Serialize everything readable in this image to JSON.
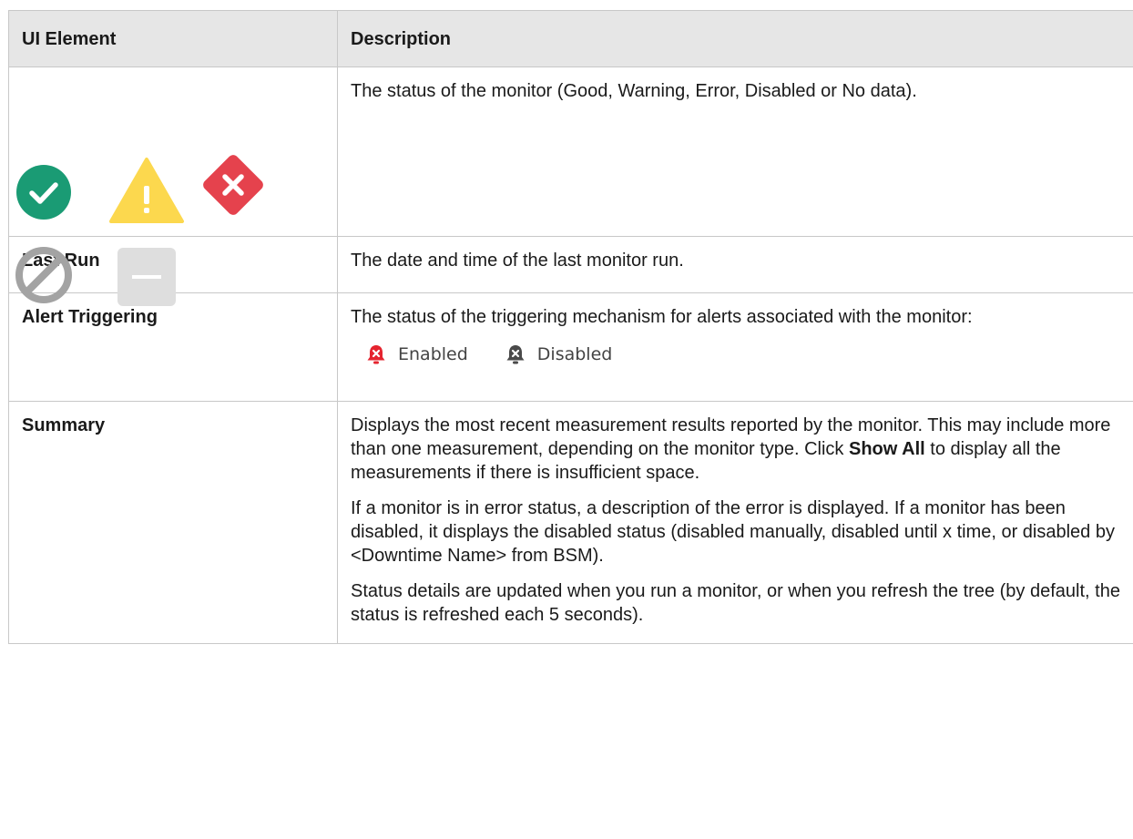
{
  "table": {
    "headers": [
      "UI Element",
      "Description"
    ],
    "status_row": {
      "icons": [
        "good-status-icon",
        "warning-status-icon",
        "error-status-icon",
        "disabled-status-icon",
        "no-data-status-icon"
      ],
      "description": "The status of the monitor (Good, Warning, Error, Disabled or No data)."
    },
    "last_run_row": {
      "label": "Last Run",
      "description": "The date and time of the last monitor run."
    },
    "alert_row": {
      "label": "Alert Triggering",
      "description": "The status of the triggering mechanism for alerts associated with the monitor:",
      "enabled_label": "Enabled",
      "disabled_label": "Disabled"
    },
    "summary_row": {
      "label": "Summary",
      "p1_before": "Displays the most recent measurement results reported by the monitor. This may include more than one measurement, depending on the monitor type. Click ",
      "p1_bold": "Show All",
      "p1_after": " to display all the measurements if there is insufficient space.",
      "p2": "If a monitor is in error status, a description of the error is displayed. If a monitor has been disabled, it displays the disabled status (disabled manually, disabled until x time, or disabled by <Downtime Name> from BSM).",
      "p3": "Status details are updated when you run a monitor, or when you refresh the tree (by default, the status is refreshed each 5 seconds)."
    }
  },
  "colors": {
    "good": "#1a9b74",
    "warning": "#fcd84e",
    "error": "#e5424d",
    "disabled": "#a3a3a3",
    "no_data": "#dedede",
    "header_bg": "#e6e6e6",
    "border": "#c8c8c8"
  }
}
